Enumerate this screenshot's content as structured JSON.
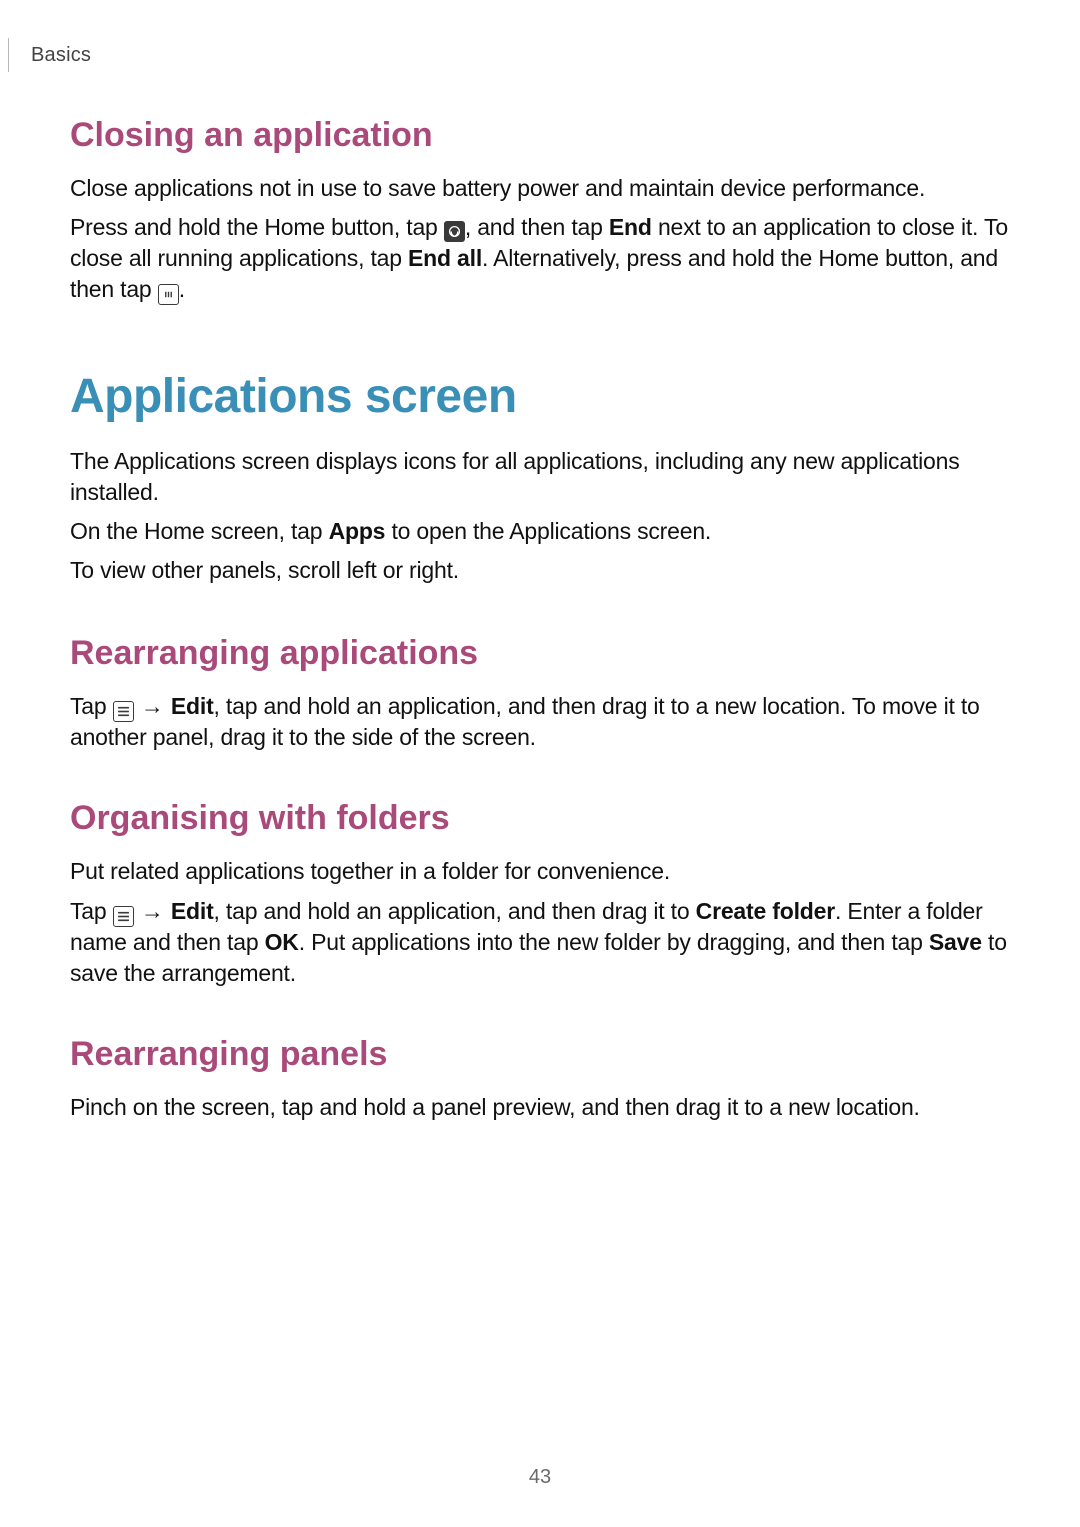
{
  "header": {
    "section": "Basics"
  },
  "closing_app": {
    "title": "Closing an application",
    "p1": "Close applications not in use to save battery power and maintain device performance.",
    "p2_a": "Press and hold the Home button, tap ",
    "p2_b": ", and then tap ",
    "end": "End",
    "p2_c": " next to an application to close it. To close all running applications, tap ",
    "end_all": "End all",
    "p2_d": ". Alternatively, press and hold the Home button, and then tap ",
    "p2_e": "."
  },
  "apps_screen": {
    "title": "Applications screen",
    "p1": "The Applications screen displays icons for all applications, including any new applications installed.",
    "p2_a": "On the Home screen, tap ",
    "apps": "Apps",
    "p2_b": " to open the Applications screen.",
    "p3": "To view other panels, scroll left or right."
  },
  "rearranging_apps": {
    "title": "Rearranging applications",
    "p1_a": "Tap ",
    "arrow": "→",
    "edit": "Edit",
    "p1_b": ", tap and hold an application, and then drag it to a new location. To move it to another panel, drag it to the side of the screen."
  },
  "organising_folders": {
    "title": "Organising with folders",
    "p1": "Put related applications together in a folder for convenience.",
    "p2_a": "Tap ",
    "arrow": "→",
    "edit": "Edit",
    "p2_b": ", tap and hold an application, and then drag it to ",
    "create_folder": "Create folder",
    "p2_c": ". Enter a folder name and then tap ",
    "ok": "OK",
    "p2_d": ". Put applications into the new folder by dragging, and then tap ",
    "save": "Save",
    "p2_e": " to save the arrangement."
  },
  "rearranging_panels": {
    "title": "Rearranging panels",
    "p1": "Pinch on the screen, tap and hold a panel preview, and then drag it to a new location."
  },
  "page_number": "43"
}
